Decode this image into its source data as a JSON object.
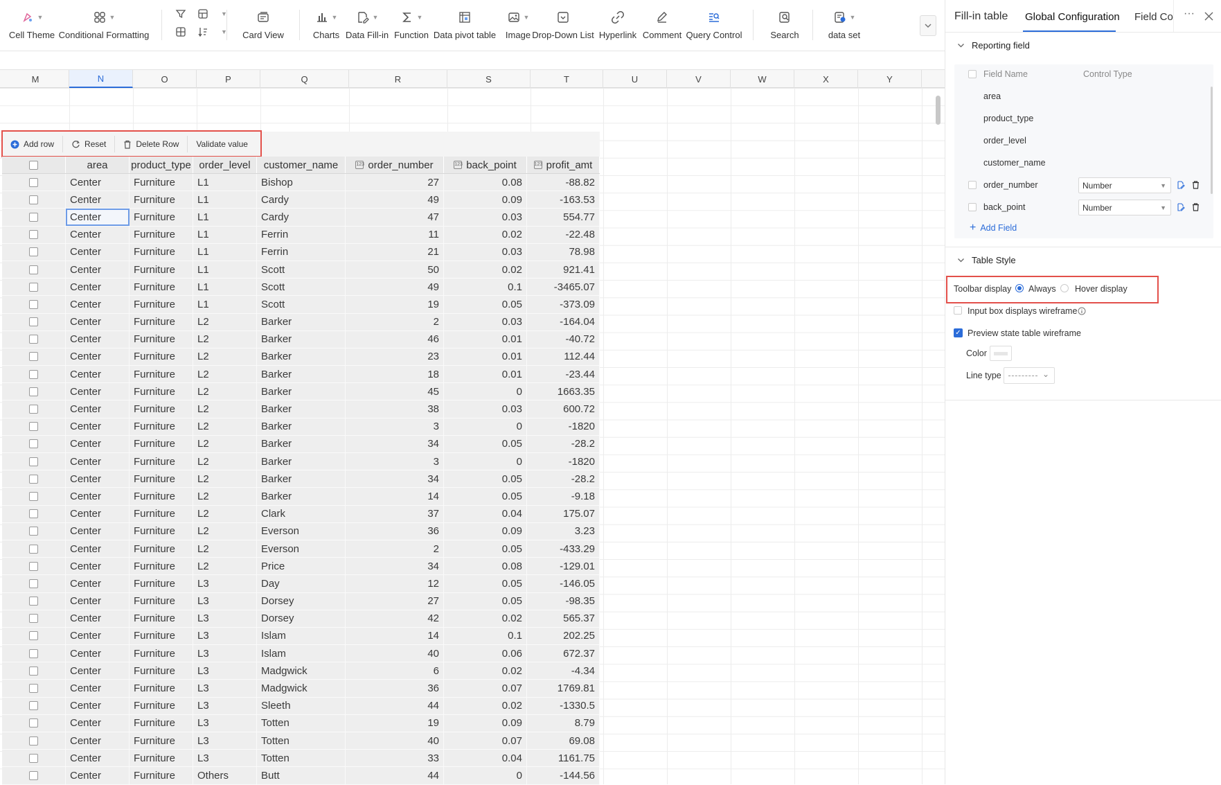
{
  "toolbar": {
    "cell_theme": "Cell Theme",
    "conditional_formatting": "Conditional Formatting",
    "card_view": "Card View",
    "charts": "Charts",
    "data_fill_in": "Data Fill-in",
    "function": "Function",
    "data_pivot_table": "Data pivot table",
    "image": "Image",
    "drop_down_list": "Drop-Down List",
    "hyperlink": "Hyperlink",
    "comment": "Comment",
    "query_control": "Query Control",
    "search": "Search",
    "data_set": "data set"
  },
  "columns": [
    "M",
    "N",
    "O",
    "P",
    "Q",
    "R",
    "S",
    "T",
    "U",
    "V",
    "W",
    "X",
    "Y"
  ],
  "active_column": "N",
  "fill_toolbar": {
    "add_row": "Add row",
    "reset": "Reset",
    "delete_row": "Delete Row",
    "validate_value": "Validate value"
  },
  "table": {
    "headers": [
      "area",
      "product_type",
      "order_level",
      "customer_name",
      "order_number",
      "back_point",
      "profit_amt"
    ],
    "rows": [
      [
        "Center",
        "Furniture",
        "L1",
        "Bishop",
        "27",
        "0.08",
        "-88.82"
      ],
      [
        "Center",
        "Furniture",
        "L1",
        "Cardy",
        "49",
        "0.09",
        "-163.53"
      ],
      [
        "Center",
        "Furniture",
        "L1",
        "Cardy",
        "47",
        "0.03",
        "554.77"
      ],
      [
        "Center",
        "Furniture",
        "L1",
        "Ferrin",
        "11",
        "0.02",
        "-22.48"
      ],
      [
        "Center",
        "Furniture",
        "L1",
        "Ferrin",
        "21",
        "0.03",
        "78.98"
      ],
      [
        "Center",
        "Furniture",
        "L1",
        "Scott",
        "50",
        "0.02",
        "921.41"
      ],
      [
        "Center",
        "Furniture",
        "L1",
        "Scott",
        "49",
        "0.1",
        "-3465.07"
      ],
      [
        "Center",
        "Furniture",
        "L1",
        "Scott",
        "19",
        "0.05",
        "-373.09"
      ],
      [
        "Center",
        "Furniture",
        "L2",
        "Barker",
        "2",
        "0.03",
        "-164.04"
      ],
      [
        "Center",
        "Furniture",
        "L2",
        "Barker",
        "46",
        "0.01",
        "-40.72"
      ],
      [
        "Center",
        "Furniture",
        "L2",
        "Barker",
        "23",
        "0.01",
        "112.44"
      ],
      [
        "Center",
        "Furniture",
        "L2",
        "Barker",
        "18",
        "0.01",
        "-23.44"
      ],
      [
        "Center",
        "Furniture",
        "L2",
        "Barker",
        "45",
        "0",
        "1663.35"
      ],
      [
        "Center",
        "Furniture",
        "L2",
        "Barker",
        "38",
        "0.03",
        "600.72"
      ],
      [
        "Center",
        "Furniture",
        "L2",
        "Barker",
        "3",
        "0",
        "-1820"
      ],
      [
        "Center",
        "Furniture",
        "L2",
        "Barker",
        "34",
        "0.05",
        "-28.2"
      ],
      [
        "Center",
        "Furniture",
        "L2",
        "Barker",
        "3",
        "0",
        "-1820"
      ],
      [
        "Center",
        "Furniture",
        "L2",
        "Barker",
        "34",
        "0.05",
        "-28.2"
      ],
      [
        "Center",
        "Furniture",
        "L2",
        "Barker",
        "14",
        "0.05",
        "-9.18"
      ],
      [
        "Center",
        "Furniture",
        "L2",
        "Clark",
        "37",
        "0.04",
        "175.07"
      ],
      [
        "Center",
        "Furniture",
        "L2",
        "Everson",
        "36",
        "0.09",
        "3.23"
      ],
      [
        "Center",
        "Furniture",
        "L2",
        "Everson",
        "2",
        "0.05",
        "-433.29"
      ],
      [
        "Center",
        "Furniture",
        "L2",
        "Price",
        "34",
        "0.08",
        "-129.01"
      ],
      [
        "Center",
        "Furniture",
        "L3",
        "Day",
        "12",
        "0.05",
        "-146.05"
      ],
      [
        "Center",
        "Furniture",
        "L3",
        "Dorsey",
        "27",
        "0.05",
        "-98.35"
      ],
      [
        "Center",
        "Furniture",
        "L3",
        "Dorsey",
        "42",
        "0.02",
        "565.37"
      ],
      [
        "Center",
        "Furniture",
        "L3",
        "Islam",
        "14",
        "0.1",
        "202.25"
      ],
      [
        "Center",
        "Furniture",
        "L3",
        "Islam",
        "40",
        "0.06",
        "672.37"
      ],
      [
        "Center",
        "Furniture",
        "L3",
        "Madgwick",
        "6",
        "0.02",
        "-4.34"
      ],
      [
        "Center",
        "Furniture",
        "L3",
        "Madgwick",
        "36",
        "0.07",
        "1769.81"
      ],
      [
        "Center",
        "Furniture",
        "L3",
        "Sleeth",
        "44",
        "0.02",
        "-1330.5"
      ],
      [
        "Center",
        "Furniture",
        "L3",
        "Totten",
        "19",
        "0.09",
        "8.79"
      ],
      [
        "Center",
        "Furniture",
        "L3",
        "Totten",
        "40",
        "0.07",
        "69.08"
      ],
      [
        "Center",
        "Furniture",
        "L3",
        "Totten",
        "33",
        "0.04",
        "1161.75"
      ],
      [
        "Center",
        "Furniture",
        "Others",
        "Butt",
        "44",
        "0",
        "-144.56"
      ]
    ]
  },
  "panel": {
    "tabs": [
      "Fill-in table",
      "Global Configuration",
      "Field Con"
    ],
    "active_tab": "Global Configuration",
    "reporting_field": "Reporting field",
    "field_name_header": "Field Name",
    "control_type_header": "Control Type",
    "fields": [
      {
        "name": "area"
      },
      {
        "name": "product_type"
      },
      {
        "name": "order_level"
      },
      {
        "name": "customer_name"
      },
      {
        "name": "order_number",
        "control": "Number"
      },
      {
        "name": "back_point",
        "control": "Number"
      }
    ],
    "add_field": "Add Field",
    "table_style": "Table Style",
    "toolbar_display": "Toolbar display",
    "always": "Always",
    "hover_display": "Hover display",
    "input_box_wireframe": "Input box displays wireframe",
    "preview_wireframe": "Preview state table wireframe",
    "color": "Color",
    "line_type": "Line type"
  },
  "colors": {
    "accent": "#2b6cd9",
    "highlight": "#e3504a"
  }
}
